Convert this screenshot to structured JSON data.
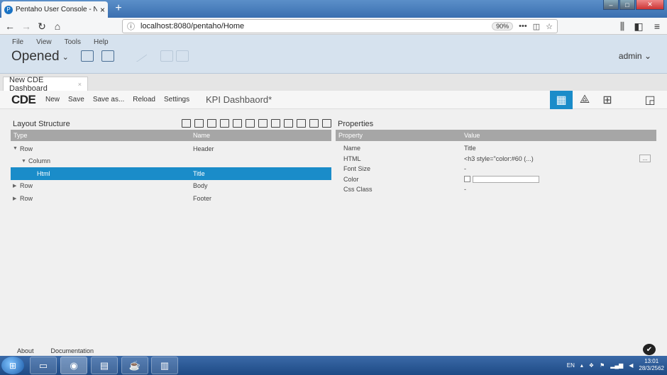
{
  "browser": {
    "tab_title": "Pentaho User Console - New C",
    "url": "localhost:8080/pentaho/Home",
    "zoom": "90%"
  },
  "pentaho": {
    "menus": [
      "File",
      "View",
      "Tools",
      "Help"
    ],
    "perspective": "Opened",
    "user": "admin"
  },
  "doc_tab": {
    "label": "New CDE Dashboard"
  },
  "cde": {
    "logo": "CDE",
    "menu": [
      "New",
      "Save",
      "Save as...",
      "Reload",
      "Settings"
    ],
    "dashboard_title": "KPI Dashbaord*"
  },
  "layout": {
    "title": "Layout Structure",
    "col_type": "Type",
    "col_name": "Name",
    "rows": [
      {
        "type": "Row",
        "name": "Header",
        "indent": 0,
        "expanded": true,
        "selected": false
      },
      {
        "type": "Column",
        "name": "",
        "indent": 1,
        "expanded": true,
        "selected": false
      },
      {
        "type": "Html",
        "name": "Title",
        "indent": 2,
        "expanded": false,
        "selected": true
      },
      {
        "type": "Row",
        "name": "Body",
        "indent": 0,
        "expanded": false,
        "selected": false
      },
      {
        "type": "Row",
        "name": "Footer",
        "indent": 0,
        "expanded": false,
        "selected": false
      }
    ]
  },
  "properties": {
    "title": "Properties",
    "col_property": "Property",
    "col_value": "Value",
    "rows": [
      {
        "property": "Name",
        "value": "Title"
      },
      {
        "property": "HTML",
        "value": "<h3 style=\"color:#60 (...)"
      },
      {
        "property": "Font Size",
        "value": "-"
      },
      {
        "property": "Color",
        "value": ""
      },
      {
        "property": "Css Class",
        "value": "-"
      }
    ],
    "more_button": "..."
  },
  "footer": {
    "about": "About",
    "documentation": "Documentation"
  },
  "taskbar": {
    "lang": "EN",
    "time": "13:01",
    "date": "28/3/2562"
  },
  "colors": {
    "accent": "#1a8cc9",
    "header_bg": "#d6e2ee",
    "table_head": "#a6a6a6"
  }
}
